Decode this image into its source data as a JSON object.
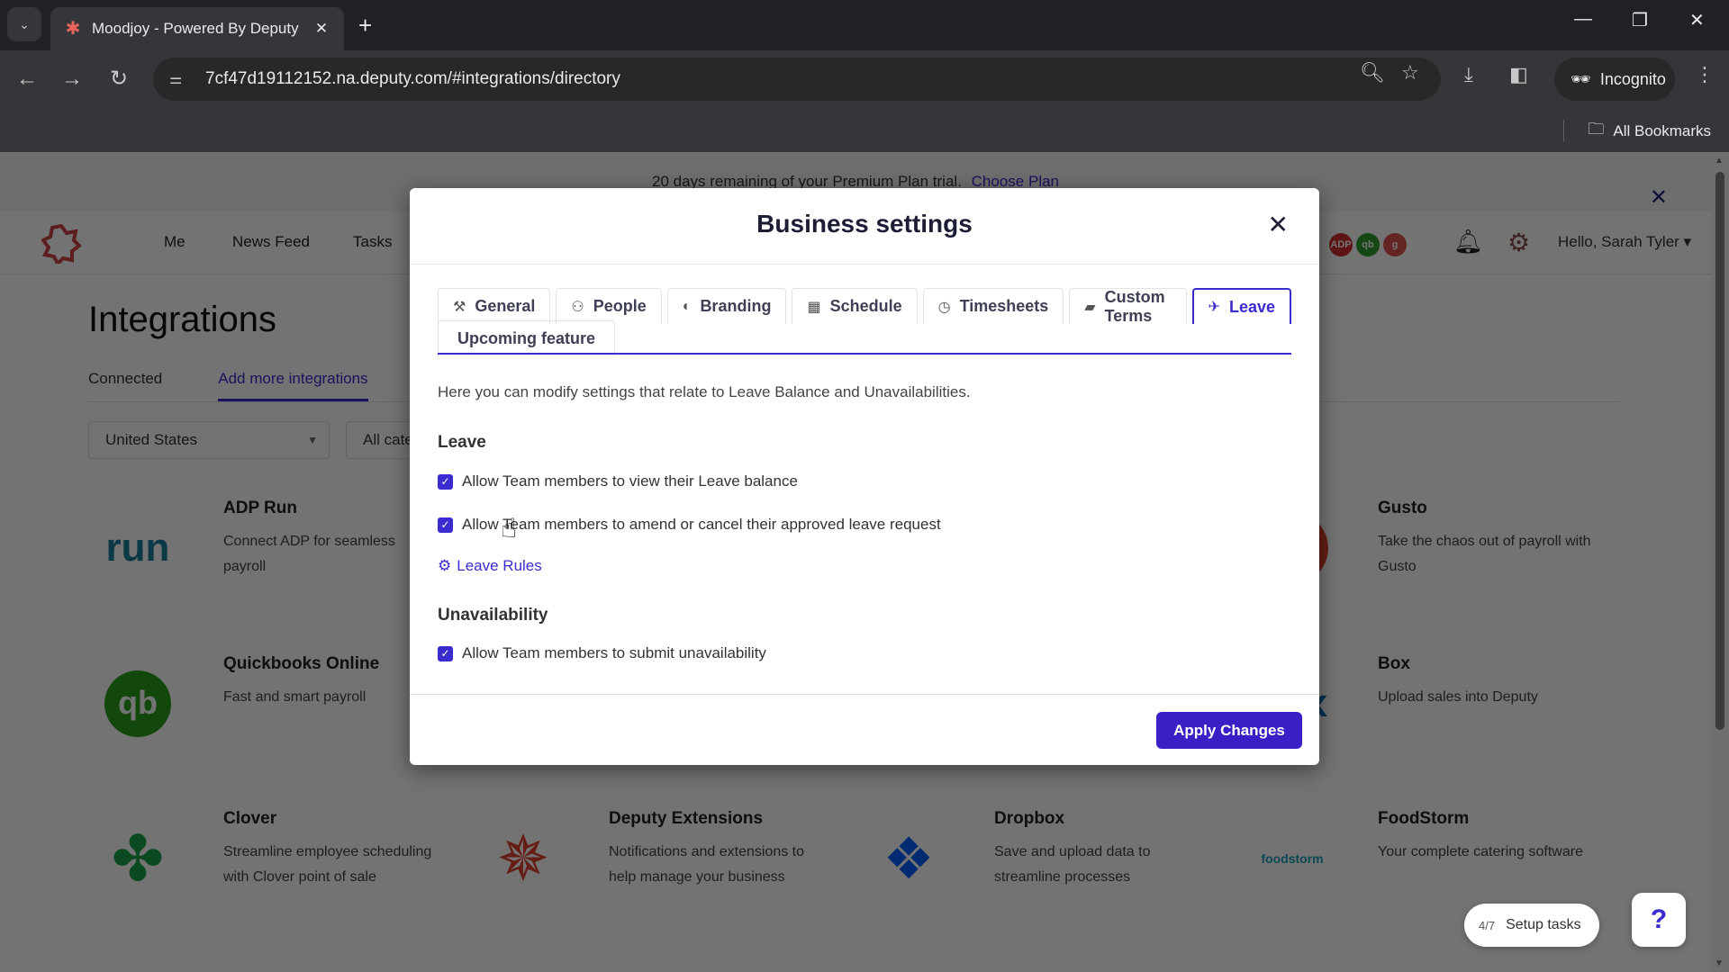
{
  "browser": {
    "tab_title": "Moodjoy - Powered By Deputy",
    "url": "7cf47d19112152.na.deputy.com/#integrations/directory",
    "incognito_label": "Incognito",
    "all_bookmarks_label": "All Bookmarks"
  },
  "banner": {
    "text": "20 days remaining of your Premium Plan trial.",
    "link": "Choose Plan"
  },
  "appnav": {
    "items": [
      "Me",
      "News Feed",
      "Tasks"
    ],
    "greeting": "Hello, Sarah Tyler",
    "integration_badges": [
      {
        "label": "ADP",
        "color": "#d32f2f"
      },
      {
        "label": "qb",
        "color": "#2e9e2e"
      },
      {
        "label": "g",
        "color": "#e05050"
      }
    ]
  },
  "integrations_page": {
    "title": "Integrations",
    "tabs": [
      {
        "label": "Connected",
        "active": false
      },
      {
        "label": "Add more integrations",
        "active": true
      }
    ],
    "country_filter": "United States",
    "category_filter": "All categories",
    "cards": [
      {
        "name": "ADP Run",
        "desc": "Connect ADP for seamless payroll",
        "logo": "run"
      },
      {
        "name": "Gusto",
        "desc": "Take the chaos out of payroll with Gusto",
        "logo": "gusto"
      },
      {
        "name": "Quickbooks Online",
        "desc": "Fast and smart payroll",
        "logo": "qb"
      },
      {
        "name": "Box",
        "desc": "Upload sales into Deputy",
        "logo": "box"
      },
      {
        "name": "Clover",
        "desc": "Streamline employee scheduling with Clover point of sale",
        "logo": "clover"
      },
      {
        "name": "Deputy Extensions",
        "desc": "Notifications and extensions to help manage your business",
        "logo": "deputy"
      },
      {
        "name": "Dropbox",
        "desc": "Save and upload data to streamline processes",
        "logo": "dropbox"
      },
      {
        "name": "FoodStorm",
        "desc": "Your complete catering software",
        "logo": "foodstorm"
      }
    ],
    "setup_tasks": {
      "count": "4/7",
      "label": "Setup tasks"
    },
    "help_label": "?"
  },
  "modal": {
    "title": "Business settings",
    "tabs": [
      {
        "label": "General",
        "icon": "tools-icon",
        "glyph": "⚒",
        "active": false
      },
      {
        "label": "People",
        "icon": "people-icon",
        "glyph": "👥",
        "active": false
      },
      {
        "label": "Branding",
        "icon": "palette-icon",
        "glyph": "◐",
        "active": false
      },
      {
        "label": "Schedule",
        "icon": "calendar-icon",
        "glyph": "▦",
        "active": false
      },
      {
        "label": "Timesheets",
        "icon": "clock-icon",
        "glyph": "◷",
        "active": false
      },
      {
        "label": "Custom Terms",
        "icon": "book-icon",
        "glyph": "▰",
        "active": false
      },
      {
        "label": "Leave",
        "icon": "plane-icon",
        "glyph": "✈",
        "active": true
      },
      {
        "label": "Upcoming feature",
        "icon": "",
        "glyph": "",
        "active": false
      }
    ],
    "intro": "Here you can modify settings that relate to Leave Balance and Unavailabilities.",
    "leave_section": {
      "title": "Leave",
      "options": [
        {
          "label": "Allow Team members to view their Leave balance",
          "checked": true
        },
        {
          "label": "Allow Team members to amend or cancel their approved leave request",
          "checked": true
        }
      ],
      "rules_link": "Leave Rules"
    },
    "unavailability_section": {
      "title": "Unavailability",
      "options": [
        {
          "label": "Allow Team members to submit unavailability",
          "checked": true
        }
      ]
    },
    "apply_label": "Apply Changes"
  }
}
